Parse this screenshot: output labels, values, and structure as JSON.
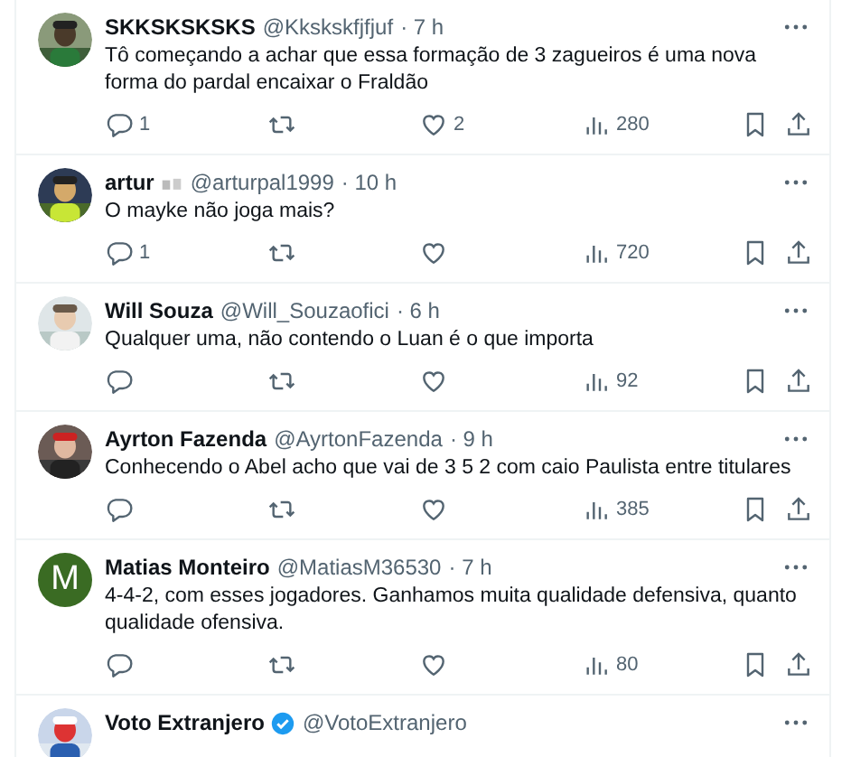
{
  "replies": [
    {
      "name": "SKKSKSKSKS",
      "handle": "@Kkskskfjfjuf",
      "time": "· 7 h",
      "text": "Tô começando a achar que essa formação de 3 zagueiros é uma nova forma do pardal encaixar o Fraldão",
      "reply_count": "1",
      "like_count": "2",
      "view_count": "280"
    },
    {
      "name": "artur",
      "name_badge": true,
      "handle": "@arturpal1999",
      "time": "· 10 h",
      "text": "O mayke não joga mais?",
      "reply_count": "1",
      "view_count": "720"
    },
    {
      "name": "Will Souza",
      "handle": "@Will_Souzaofici",
      "time": "· 6 h",
      "text": "Qualquer uma, não contendo o Luan é o que importa",
      "view_count": "92"
    },
    {
      "name": "Ayrton Fazenda",
      "handle": "@AyrtonFazenda",
      "time": "· 9 h",
      "text": "Conhecendo o Abel acho que vai de 3 5 2 com caio Paulista entre titulares",
      "view_count": "385"
    },
    {
      "avatar": {
        "kind": "letter",
        "letter": "M",
        "color": "#3a6b23"
      },
      "name": "Matias Monteiro",
      "handle": "@MatiasM36530",
      "time": "· 7 h",
      "text": "4-4-2, com esses jogadores. Ganhamos muita qualidade defensiva, quanto qualidade ofensiva.",
      "view_count": "80"
    },
    {
      "name": "Voto Extranjero",
      "verified": true,
      "handle": "@VotoExtranjero",
      "cut": true
    }
  ]
}
